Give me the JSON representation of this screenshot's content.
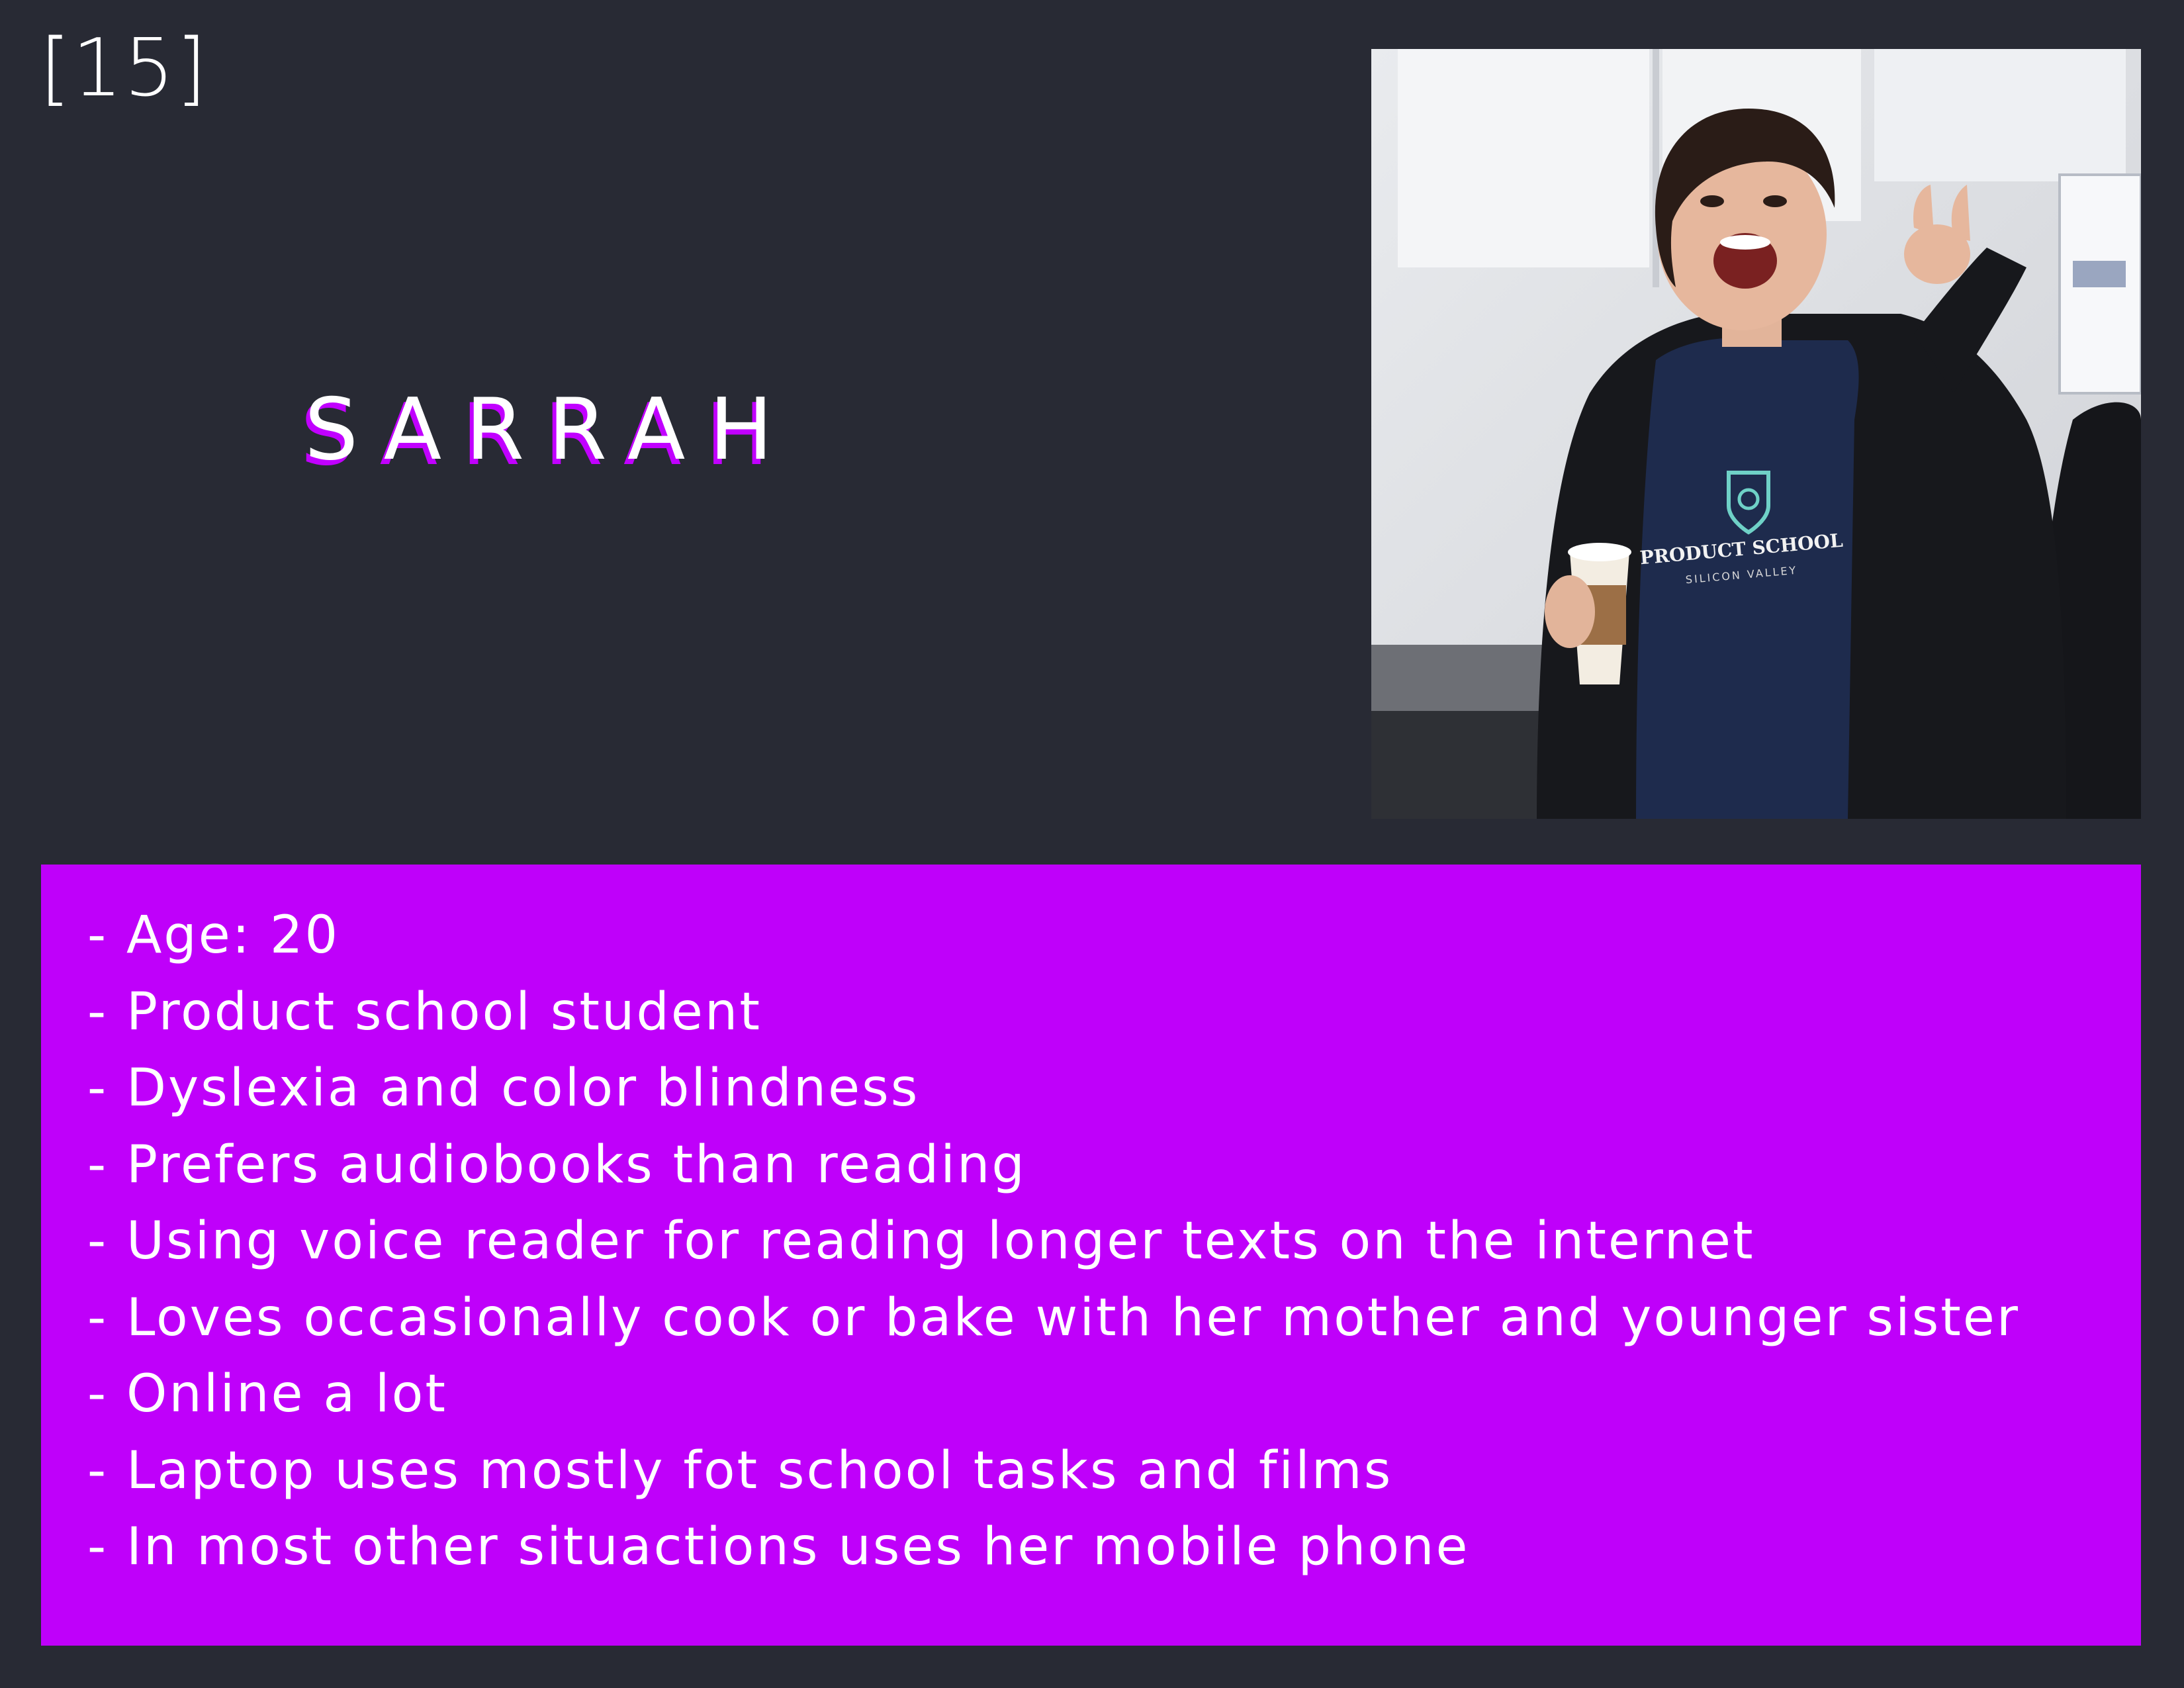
{
  "slide": {
    "page_number": "[15]",
    "persona_name": "SARRAH"
  },
  "photo": {
    "shirt_title": "PRODUCT SCHOOL",
    "shirt_subtitle": "SILICON VALLEY"
  },
  "details": [
    "- Age: 20",
    "- Product school student",
    "- Dyslexia and color blindness",
    "- Prefers audiobooks than reading",
    "- Using voice reader for reading longer texts on the internet",
    "- Loves occasionally cook or bake with her mother and younger sister",
    "- Online a lot",
    "- Laptop uses mostly fot school tasks and films",
    "- In most other situactions uses her mobile phone"
  ],
  "colors": {
    "background": "#282a34",
    "accent": "#bf00fa",
    "text": "#ffffff"
  }
}
